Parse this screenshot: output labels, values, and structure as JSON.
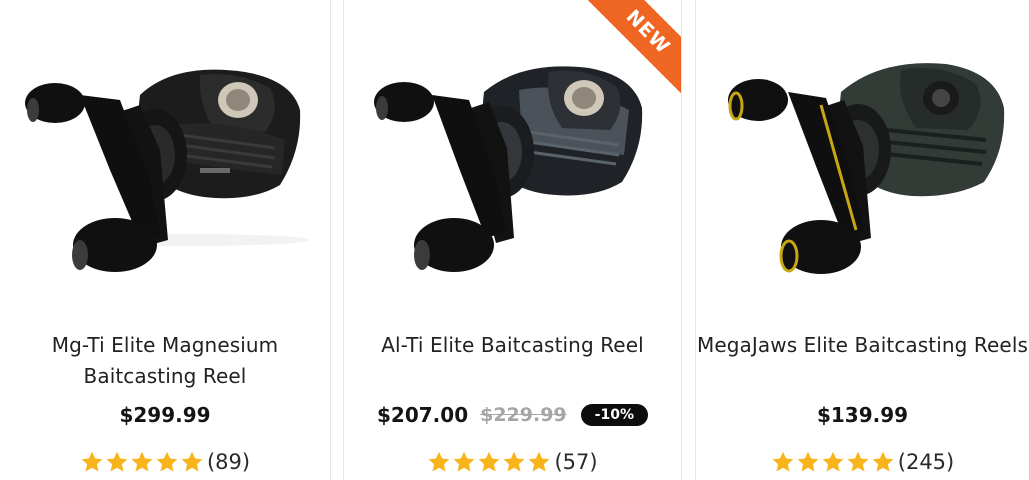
{
  "products": [
    {
      "title": "Mg-Ti Elite Magnesium Baitcasting Reel",
      "price": "$299.99",
      "rating_count": "(89)",
      "rating": 5
    },
    {
      "title": "Al-Ti Elite Baitcasting Reel",
      "price": "$207.00",
      "old_price": "$229.99",
      "discount": "-10%",
      "badge": "NEW",
      "rating_count": "(57)",
      "rating": 5
    },
    {
      "title": "MegaJaws Elite Baitcasting Reels",
      "price": "$139.99",
      "rating_count": "(245)",
      "rating": 5
    }
  ],
  "colors": {
    "star": "#f7b51b",
    "badge": "#ef6522",
    "accent_yellow": "#c9a712",
    "reel_body": "#1c1c1c",
    "reel_body_green": "#333b37"
  },
  "icons": [
    "star-icon",
    "product-image-reel"
  ]
}
